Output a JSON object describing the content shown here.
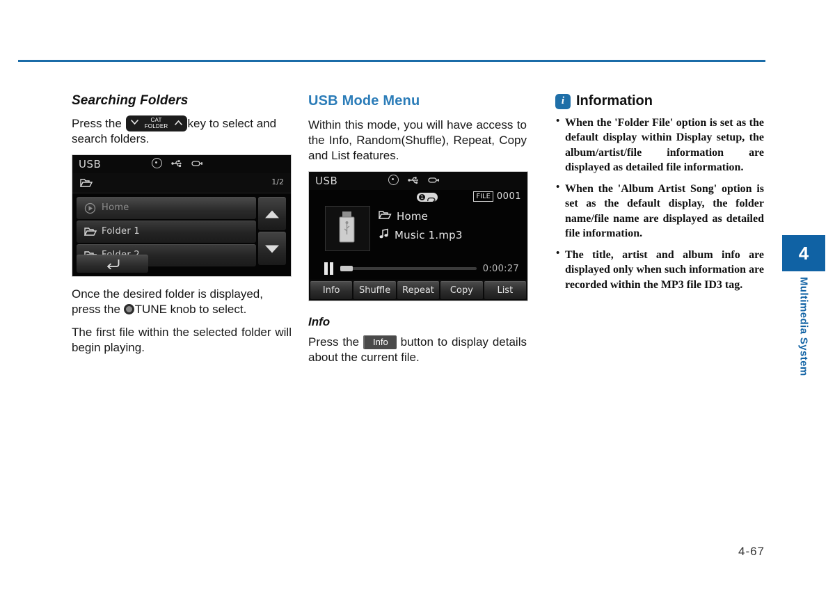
{
  "page": {
    "number": "4-67",
    "chapter_number": "4",
    "chapter_label": "Multimedia System"
  },
  "left_column": {
    "heading": "Searching Folders",
    "intro_before_key": "Press the",
    "key_glyph": {
      "name": "cat-folder-key",
      "line1": "CAT",
      "line2": "FOLDER",
      "left_icon": "chevron-down-icon",
      "right_icon": "chevron-up-icon"
    },
    "intro_after_key": "key to select and search folders.",
    "paragraph_1_before_knob": "Once the desired folder is displayed, press the",
    "knob_icon": "tune-knob-icon",
    "paragraph_1_after_knob": "TUNE knob to select.",
    "paragraph_2": "The first file within the selected folder will begin playing.",
    "screenshot": {
      "title": "USB",
      "status_icons": [
        "disc-icon",
        "usb-icon",
        "connector-icon"
      ],
      "page_indicator": "1/2",
      "path_icon": "folder-open-icon",
      "rows": [
        {
          "label": "Home",
          "icon": "play-circle-icon",
          "selected": true
        },
        {
          "label": "Folder 1",
          "icon": "folder-icon",
          "selected": false
        },
        {
          "label": "Folder 2",
          "icon": "folder-icon",
          "selected": false
        }
      ],
      "scroll_up": "scroll-up-icon",
      "scroll_down": "scroll-down-icon",
      "back_button": "back-icon"
    }
  },
  "middle_column": {
    "heading": "USB Mode Menu",
    "paragraph": "Within this mode, you will have access to the Info, Random(Shuffle), Repeat, Copy and List features.",
    "subheading": "Info",
    "info_before_button": "Press the",
    "info_button_label": "Info",
    "info_after_button": "button to display details about the current file.",
    "screenshot": {
      "title": "USB",
      "status_icons": [
        "disc-icon",
        "usb-icon",
        "connector-icon"
      ],
      "flag_number": "1",
      "flag_icon": "repeat-icon",
      "file_tag": "FILE",
      "file_number": "0001",
      "album_art_icon": "usb-stick-icon",
      "folder_icon": "folder-icon",
      "folder_name": "Home",
      "track_icon": "music-note-icon",
      "track_name": "Music 1.mp3",
      "transport_icon": "pause-icon",
      "elapsed_time": "0:00:27",
      "progress_percent": 9,
      "buttons": [
        "Info",
        "Shuffle",
        "Repeat",
        "Copy",
        "List"
      ]
    }
  },
  "right_column": {
    "icon": "info-icon",
    "title": "Information",
    "items": [
      "When the 'Folder File' option is set as the default display within Display setup, the album/artist/file information are displayed as detailed file information.",
      "When the 'Album Artist Song' option is set as the default display, the folder name/file name are displayed as detailed file information.",
      "The title, artist and album info are displayed only when such information are recorded within the MP3 file ID3 tag."
    ]
  },
  "colors": {
    "accent_blue": "#1b6ca8",
    "heading_blue": "#2b7cb8",
    "tab_blue": "#1062a4"
  }
}
